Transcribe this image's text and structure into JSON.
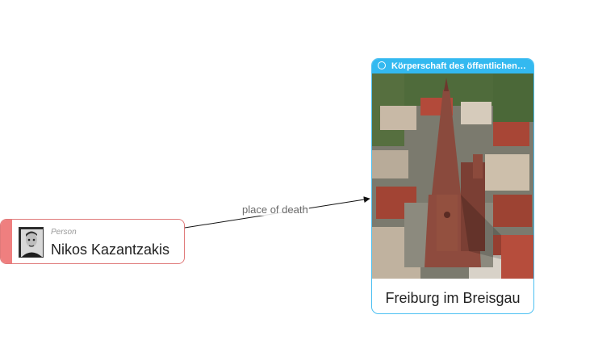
{
  "edges": [
    {
      "label": "place of death"
    }
  ],
  "nodes": {
    "person": {
      "type_label": "Person",
      "name": "Nikos Kazantzakis",
      "accent_color": "#ef7f7f",
      "icon": "person-portrait"
    },
    "place": {
      "header_label": "Körperschaft des öffentlichen…",
      "header_icon": "circle-icon",
      "name": "Freiburg im Breisgau",
      "accent_color": "#33b9f0",
      "image": "aerial-photo-cathedral"
    }
  }
}
